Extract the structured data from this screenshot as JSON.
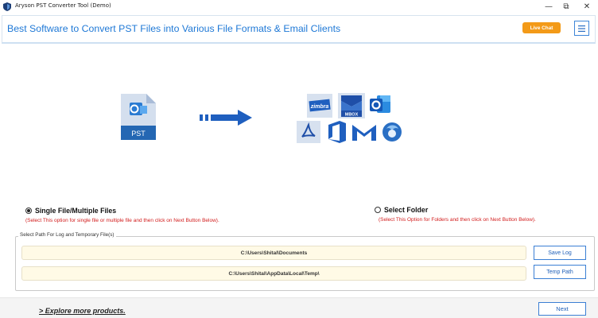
{
  "window": {
    "title": "Aryson PST Converter Tool (Demo)",
    "controls": {
      "minimize": "—",
      "restore": "⧉",
      "close": "✕"
    }
  },
  "banner": {
    "title": "Best Software to Convert PST Files into Various File Formats & Email Clients",
    "live_chat_label": "Live Chat",
    "menu_icon": "hamburger-menu-icon"
  },
  "illustration": {
    "source_label": "PST",
    "target_labels": {
      "zimbra": "zimbra",
      "mbox": "MBOX"
    }
  },
  "options": {
    "single": {
      "label": "Single File/Multiple Files",
      "hint": "(Select This option for single file or multiple file and then click on Next Button Below).",
      "selected": true
    },
    "folder": {
      "label": "Select Folder",
      "hint": "(Select This Option for Folders and then click on Next Button Below).",
      "selected": false
    }
  },
  "paths": {
    "legend": "Select Path For Log and Temporary File(s)",
    "log_path": "C:\\Users\\Shital\\Documents",
    "temp_path": "C:\\Users\\Shital\\AppData\\Local\\Temp\\",
    "save_log_label": "Save Log",
    "temp_path_label": "Temp Path"
  },
  "footer": {
    "explore_label": "> Explore more products.",
    "next_label": "Next"
  },
  "colors": {
    "brand_blue": "#1e78d6",
    "live_chat_orange": "#f39a18",
    "hint_red": "#d21c1c",
    "path_bg": "#fffae6"
  }
}
